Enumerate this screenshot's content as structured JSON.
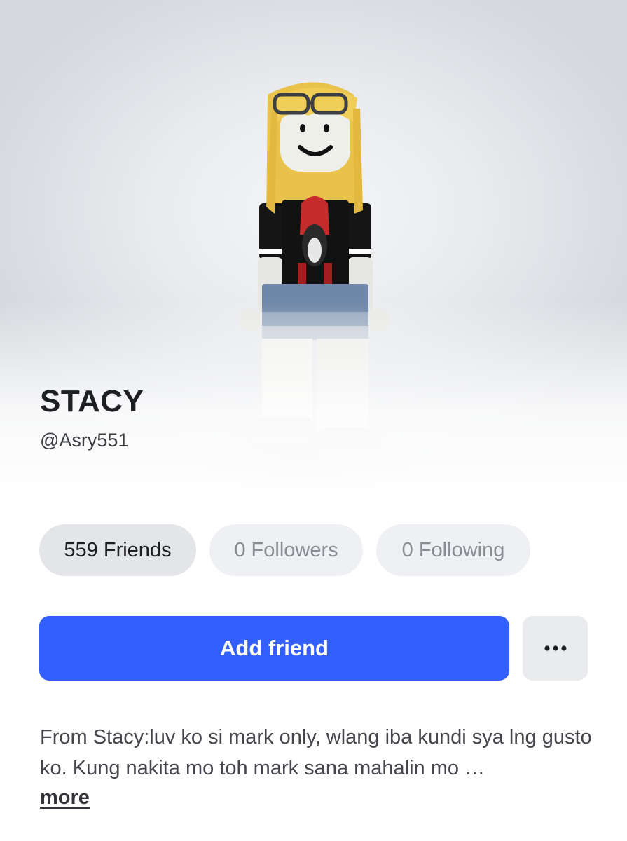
{
  "profile": {
    "display_name": "STACY",
    "username": "@Asry551",
    "avatar_icon": "avatar-icon"
  },
  "stats": {
    "friends": "559 Friends",
    "followers": "0 Followers",
    "following": "0 Following"
  },
  "actions": {
    "add_friend": "Add friend",
    "more": "···"
  },
  "about": {
    "bio": "From Stacy:luv ko si mark only, wlang iba kundi sya lng gusto ko. Kung nakita mo toh mark sana mahalin mo …",
    "more_label": "more"
  },
  "colors": {
    "accent": "#335fff",
    "chip_bg": "#eff0f3",
    "text": "#1e1f23"
  }
}
